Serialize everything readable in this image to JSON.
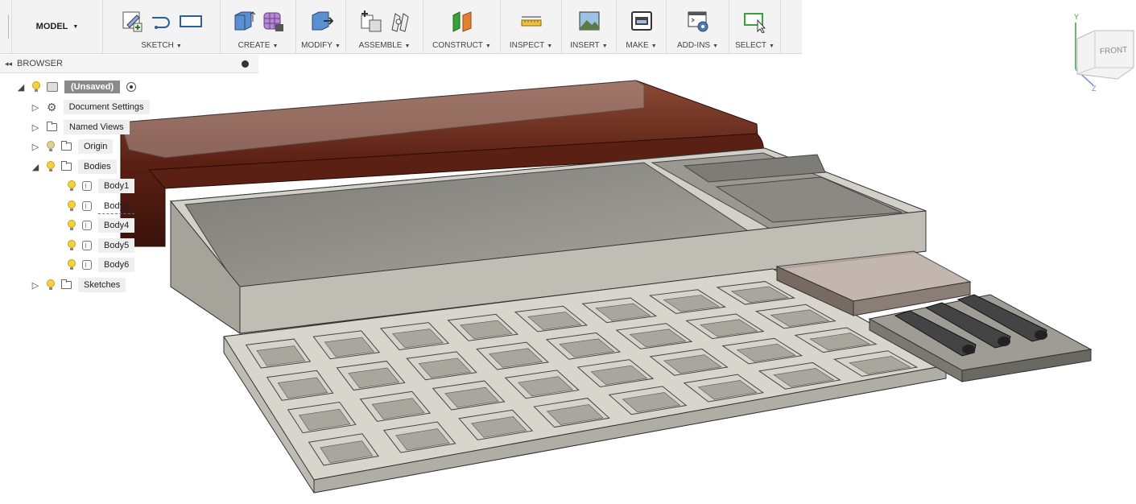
{
  "toolbar": {
    "model_label": "MODEL",
    "groups": [
      {
        "label": "SKETCH"
      },
      {
        "label": "CREATE"
      },
      {
        "label": "MODIFY"
      },
      {
        "label": "ASSEMBLE"
      },
      {
        "label": "CONSTRUCT"
      },
      {
        "label": "INSPECT"
      },
      {
        "label": "INSERT"
      },
      {
        "label": "MAKE"
      },
      {
        "label": "ADD-INS"
      },
      {
        "label": "SELECT"
      }
    ],
    "dropdown_arrow": "▼"
  },
  "browser": {
    "title": "BROWSER",
    "collapse_glyph": "◂◂",
    "root": {
      "label": "(Unsaved)"
    },
    "items": [
      {
        "label": "Document Settings"
      },
      {
        "label": "Named Views"
      },
      {
        "label": "Origin"
      },
      {
        "label": "Bodies"
      },
      {
        "label": "Body1"
      },
      {
        "label": "Body3"
      },
      {
        "label": "Body4"
      },
      {
        "label": "Body5"
      },
      {
        "label": "Body6"
      },
      {
        "label": "Sketches"
      }
    ]
  },
  "viewcube": {
    "face_label": "FRONT",
    "axis_y": "Y",
    "axis_z": "Z"
  },
  "colors": {
    "wood": "#6b2a1a",
    "tray_gray": "#b9b6ad",
    "grid_cell": "#d6d3ca",
    "accent_green": "#3aa13a"
  }
}
